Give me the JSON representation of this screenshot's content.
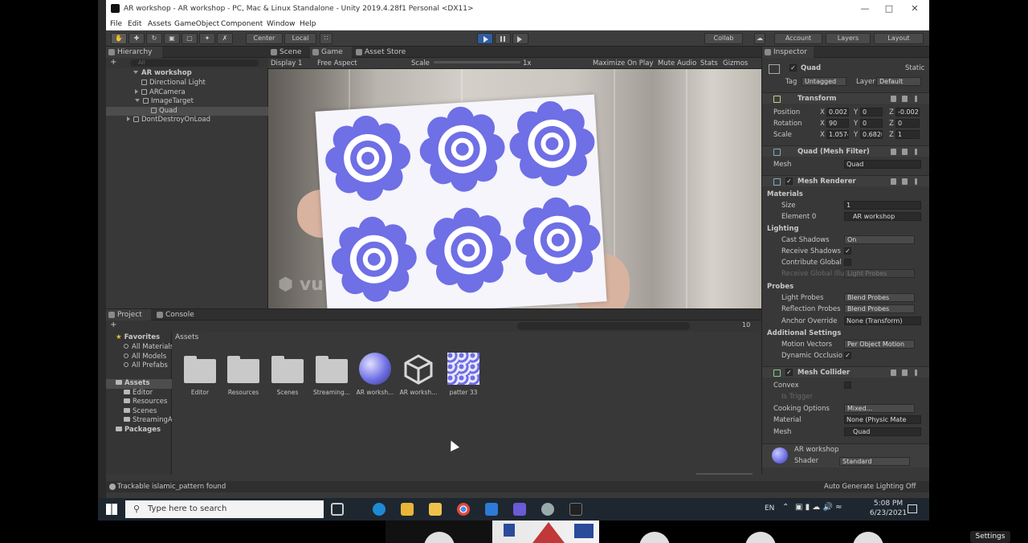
{
  "window": {
    "title": "AR workshop - AR workshop - PC, Mac & Linux Standalone - Unity 2019.4.28f1 Personal <DX11>"
  },
  "menu": [
    "File",
    "Edit",
    "Assets",
    "GameObject",
    "Component",
    "Window",
    "Help"
  ],
  "toolbar": {
    "center": "Center",
    "local": "Local",
    "collab": "Collab",
    "account": "Account",
    "layers": "Layers",
    "layout": "Layout"
  },
  "hierarchy": {
    "tab": "Hierarchy",
    "search_placeholder": "All",
    "items": [
      {
        "label": "AR workshop"
      },
      {
        "label": "Directional Light"
      },
      {
        "label": "ARCamera"
      },
      {
        "label": "ImageTarget"
      },
      {
        "label": "Quad"
      },
      {
        "label": "DontDestroyOnLoad"
      }
    ]
  },
  "game": {
    "tabs": [
      "Scene",
      "Game",
      "Asset Store"
    ],
    "display": "Display 1",
    "aspect": "Free Aspect",
    "scale_label": "Scale",
    "scale_value": "1x",
    "maximize": "Maximize On Play",
    "mute": "Mute Audio",
    "stats": "Stats",
    "gizmos": "Gizmos",
    "watermark": "vu"
  },
  "inspector": {
    "tab": "Inspector",
    "object_name": "Quad",
    "static_label": "Static",
    "tag_label": "Tag",
    "tag_value": "Untagged",
    "layer_label": "Layer",
    "layer_value": "Default",
    "transform": {
      "title": "Transform",
      "position_label": "Position",
      "position": [
        "0.002",
        "0",
        "-0.002"
      ],
      "rotation_label": "Rotation",
      "rotation": [
        "90",
        "0",
        "0"
      ],
      "scale_label": "Scale",
      "scale": [
        "1.0574",
        "0.6820",
        "1"
      ]
    },
    "mesh_filter": {
      "title": "Quad (Mesh Filter)",
      "mesh_label": "Mesh",
      "mesh_value": "Quad"
    },
    "mesh_renderer": {
      "title": "Mesh Renderer",
      "materials": "Materials",
      "size_label": "Size",
      "size_value": "1",
      "element0_label": "Element 0",
      "element0_value": "AR workshop",
      "lighting": "Lighting",
      "cast_label": "Cast Shadows",
      "cast_value": "On",
      "receive_label": "Receive Shadows",
      "contribute_label": "Contribute Global I",
      "receive_gi_label": "Receive Global Illu",
      "receive_gi_value": "Light Probes",
      "probes": "Probes",
      "light_probes_label": "Light Probes",
      "light_probes_value": "Blend Probes",
      "reflection_label": "Reflection Probes",
      "reflection_value": "Blend Probes",
      "anchor_label": "Anchor Override",
      "anchor_value": "None (Transform)",
      "additional": "Additional Settings",
      "motion_label": "Motion Vectors",
      "motion_value": "Per Object Motion",
      "dynamic_label": "Dynamic Occlusio"
    },
    "mesh_collider": {
      "title": "Mesh Collider",
      "convex_label": "Convex",
      "trigger_label": "Is Trigger",
      "cooking_label": "Cooking Options",
      "cooking_value": "Mixed...",
      "material_label": "Material",
      "material_value": "None (Physic Mate",
      "mesh_label": "Mesh",
      "mesh_value": "Quad"
    },
    "material": {
      "name": "AR workshop",
      "shader_label": "Shader",
      "shader_value": "Standard"
    }
  },
  "project": {
    "tabs": [
      "Project",
      "Console"
    ],
    "count": "10",
    "breadcrumb": "Assets",
    "tree": [
      {
        "label": "Favorites"
      },
      {
        "label": "All Materials"
      },
      {
        "label": "All Models"
      },
      {
        "label": "All Prefabs"
      },
      {
        "label": "Assets"
      },
      {
        "label": "Editor"
      },
      {
        "label": "Resources"
      },
      {
        "label": "Scenes"
      },
      {
        "label": "StreamingAssets"
      },
      {
        "label": "Packages"
      }
    ],
    "assets": [
      {
        "label": "Editor"
      },
      {
        "label": "Resources"
      },
      {
        "label": "Scenes"
      },
      {
        "label": "Streaming..."
      },
      {
        "label": "AR worksh..."
      },
      {
        "label": "AR worksh..."
      },
      {
        "label": "patter 33"
      }
    ]
  },
  "status": {
    "message": "Trackable islamic_pattern found",
    "right": "Auto Generate Lighting Off"
  },
  "taskbar": {
    "search_placeholder": "Type here to search",
    "lang": "EN",
    "time": "5:08 PM",
    "date": "6/23/2021"
  },
  "meeting": {
    "settings": "Settings"
  }
}
